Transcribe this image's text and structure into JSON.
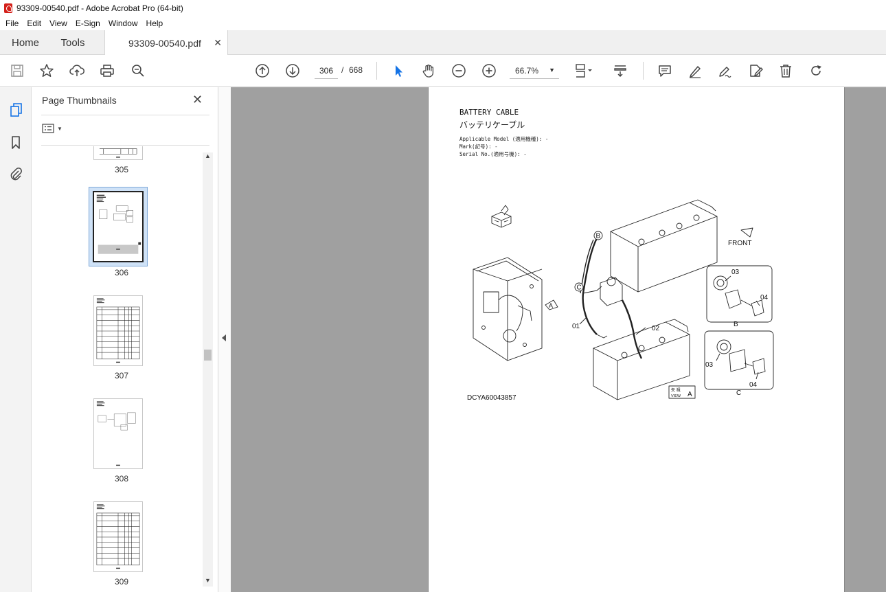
{
  "window": {
    "title": "93309-00540.pdf - Adobe Acrobat Pro (64-bit)"
  },
  "menu": [
    "File",
    "Edit",
    "View",
    "E-Sign",
    "Window",
    "Help"
  ],
  "tabs": {
    "home": "Home",
    "tools": "Tools",
    "document": "93309-00540.pdf"
  },
  "toolbar": {
    "current_page": "306",
    "page_separator": "/",
    "total_pages": "668",
    "zoom": "66.7%"
  },
  "icons": {
    "save": "save-icon",
    "bookmark": "star-icon",
    "upload": "upload-cloud-icon",
    "print": "printer-icon",
    "find": "zoom-search-icon",
    "prev_page": "arrow-up-circle-icon",
    "next_page": "arrow-down-circle-icon",
    "select": "cursor-arrow-icon",
    "hand": "hand-icon",
    "zoom_out": "minus-circle-icon",
    "zoom_in": "plus-circle-icon",
    "page_display": "page-fit-icon",
    "scroll_mode": "scroll-mode-icon",
    "comment": "comment-icon",
    "highlight": "pen-icon",
    "sign": "sign-icon",
    "edit": "edit-pdf-icon",
    "delete": "trash-icon",
    "rotate": "rotate-icon"
  },
  "panel": {
    "title": "Page Thumbnails",
    "thumbnails": [
      {
        "label": "305",
        "selected": false
      },
      {
        "label": "306",
        "selected": true
      },
      {
        "label": "307",
        "selected": false
      },
      {
        "label": "308",
        "selected": false
      },
      {
        "label": "309",
        "selected": false
      }
    ]
  },
  "document": {
    "title_en": "BATTERY CABLE",
    "title_jp": "バッテリケーブル",
    "applicable_model": "Applicable Model (適用機種): -",
    "mark": "Mark(記号): -",
    "serial_no": "Serial No.(適用号機): -",
    "drawing_code": "DCYA60043857",
    "labels": {
      "front": "FRONT",
      "part_01": "01",
      "part_02": "02",
      "part_03": "03",
      "part_04": "04",
      "callout_a": "A",
      "callout_b": "B",
      "callout_c": "C",
      "view_jp": "矢 視",
      "view": "VIEW"
    }
  },
  "colors": {
    "accent_blue": "#1473e6",
    "pdf_red": "#d4201a",
    "viewer_bg": "#a0a0a0"
  }
}
